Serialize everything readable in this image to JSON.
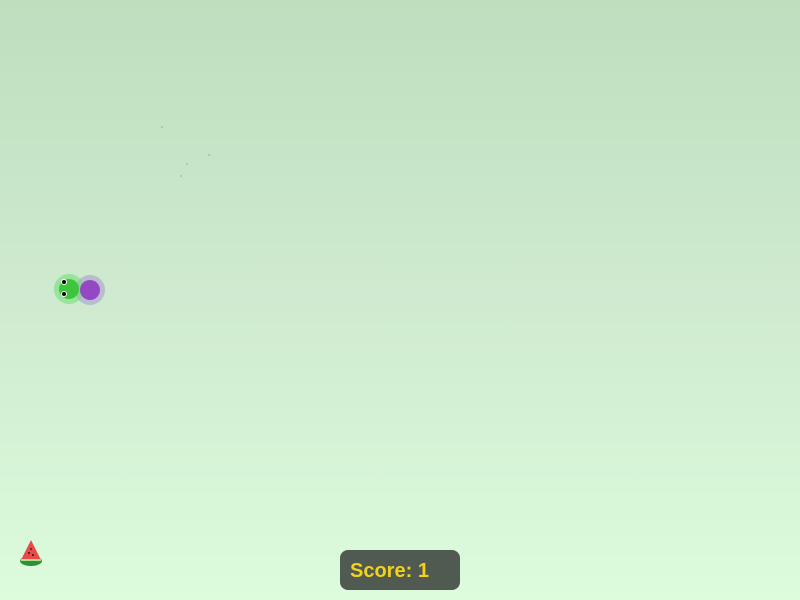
{
  "score": {
    "label": "Score:",
    "value": "1"
  },
  "snake": {
    "length": 2,
    "direction": "left",
    "head_color": "#3dc53d",
    "body_color": "#9448c4"
  },
  "food": {
    "item": "watermelon-icon",
    "color": "#e84a4a"
  },
  "colors": {
    "background_top": "#bddfbe",
    "background_bottom": "#dcfcdc",
    "score_text": "#f2d21a",
    "score_background": "#515a50"
  }
}
